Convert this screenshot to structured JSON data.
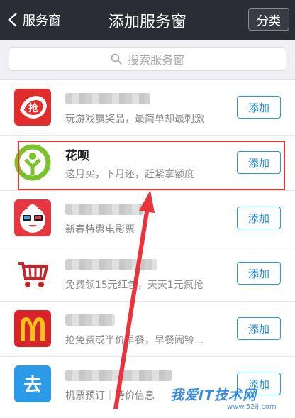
{
  "nav": {
    "back_label": "服务窗",
    "title": "添加服务窗",
    "right_button": "分类"
  },
  "search": {
    "placeholder": "搜索服务窗"
  },
  "items": [
    {
      "name": "",
      "desc": "玩游戏赢奖品，最简单却最刺激",
      "add": "添加",
      "icon": "red-envelope-logo"
    },
    {
      "name": "花呗",
      "desc": "这月买，下月还，赶紧拿额度",
      "add": "添加",
      "icon": "huabei-logo"
    },
    {
      "name": "",
      "desc": "新春特惠电影票",
      "add": "添加",
      "icon": "movie-mascot-logo"
    },
    {
      "name": "",
      "desc": "免费领15元红包，天天1元疯抢",
      "add": "添加",
      "icon": "shopping-cart-logo"
    },
    {
      "name": "",
      "desc": "抢免费或半价早餐，早餐闹铃...",
      "add": "添加",
      "icon": "mcdonalds-logo"
    },
    {
      "name": "",
      "desc": "机票预订｜特价信息",
      "add": "添加",
      "icon": "travel-logo"
    }
  ],
  "watermark": {
    "text": "我爱IT技术网",
    "sub": "www.52ij.com"
  },
  "colors": {
    "nav_bg": "#2b2d35",
    "accent": "#1a8ee0",
    "highlight": "#e0393b"
  }
}
